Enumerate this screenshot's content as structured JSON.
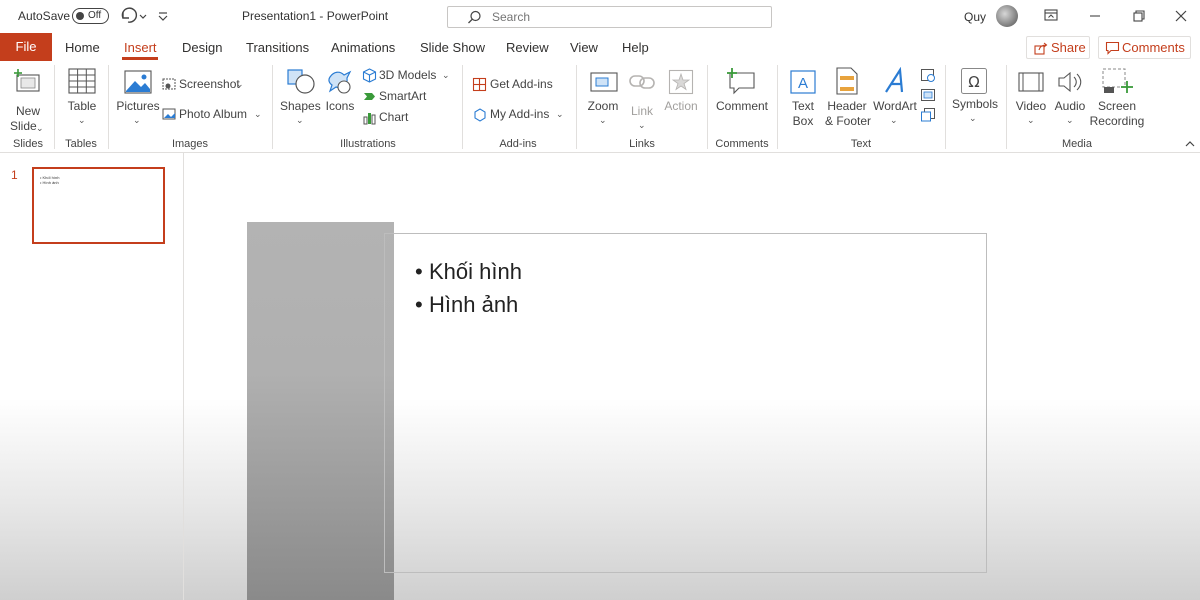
{
  "titlebar": {
    "autosave_label": "AutoSave",
    "autosave_state": "Off",
    "document_title": "Presentation1  -  PowerPoint",
    "search_placeholder": "Search",
    "user_name": "Quy"
  },
  "tabs": {
    "file": "File",
    "items": [
      "Home",
      "Insert",
      "Design",
      "Transitions",
      "Animations",
      "Slide Show",
      "Review",
      "View",
      "Help"
    ],
    "active": "Insert",
    "share": "Share",
    "comments": "Comments"
  },
  "ribbon": {
    "groups": {
      "slides": "Slides",
      "tables": "Tables",
      "images": "Images",
      "illustrations": "Illustrations",
      "addins": "Add-ins",
      "links": "Links",
      "comments": "Comments",
      "text": "Text",
      "media": "Media"
    },
    "new_slide_1": "New",
    "new_slide_2": "Slide",
    "table": "Table",
    "pictures": "Pictures",
    "screenshot": "Screenshot",
    "photo_album": "Photo Album",
    "shapes": "Shapes",
    "icons": "Icons",
    "models_3d": "3D Models",
    "smartart": "SmartArt",
    "chart": "Chart",
    "get_addins": "Get Add-ins",
    "my_addins": "My Add-ins",
    "zoom": "Zoom",
    "link": "Link",
    "action": "Action",
    "comment": "Comment",
    "text_box_1": "Text",
    "text_box_2": "Box",
    "header_footer_1": "Header",
    "header_footer_2": "& Footer",
    "wordart": "WordArt",
    "symbols": "Symbols",
    "video": "Video",
    "audio": "Audio",
    "screen_recording_1": "Screen",
    "screen_recording_2": "Recording"
  },
  "colors": {
    "accent": "#c43e1c"
  },
  "slides": [
    {
      "number": "1",
      "bullets": [
        "Khối hình",
        "Hình ảnh"
      ]
    }
  ]
}
